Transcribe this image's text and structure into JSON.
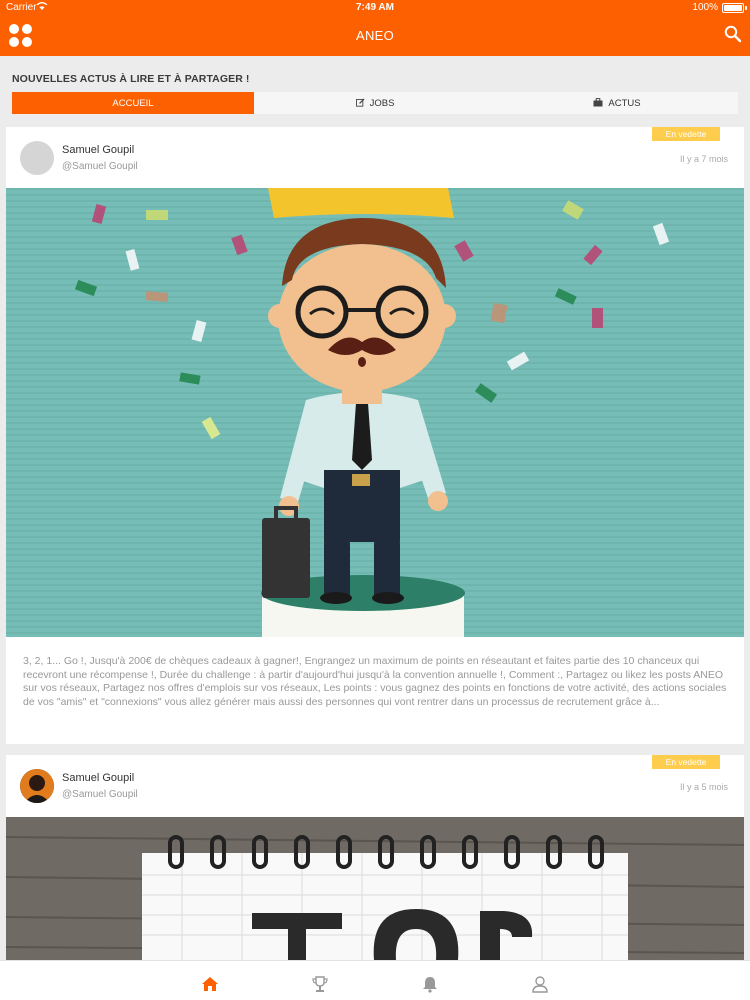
{
  "status_bar": {
    "carrier": "Carrier",
    "time": "7:49 AM",
    "battery": "100%"
  },
  "app_bar": {
    "title": "ANEO",
    "menu_icon": "grid-icon",
    "search_icon": "search-icon"
  },
  "colors": {
    "accent": "#fd6000",
    "badge": "#ffcd4d",
    "background": "#ececec"
  },
  "header": {
    "tagline": "NOUVELLES ACTUS À LIRE ET À PARTAGER !"
  },
  "tabs": [
    {
      "label": "ACCUEIL",
      "icon": null,
      "active": true
    },
    {
      "label": "JOBS",
      "icon": "edit-icon",
      "active": false
    },
    {
      "label": "ACTUS",
      "icon": "briefcase-icon",
      "active": false
    }
  ],
  "posts": [
    {
      "author": "Samuel Goupil",
      "handle": "@Samuel Goupil",
      "badge": "En vedette",
      "time_ago": "Il y a 7 mois",
      "image": "cartoon-man-with-crown-and-confetti",
      "excerpt": "3, 2, 1... Go !, Jusqu'à 200€ de chèques cadeaux à gagner!, Engrangez un maximum de points en réseautant et faites partie des 10 chanceux qui recevront une récompense !, Durée du challenge : à partir d'aujourd'hui jusqu'à la convention annuelle !, Comment :, Partagez ou likez les posts ANEO sur vos réseaux, Partagez nos offres d'emplois sur vos réseaux, Les points : vous gagnez des points en fonctions de votre activité, des actions sociales de vos \"amis\" et \"connexions\" vous allez générer mais aussi des personnes qui vont rentrer dans un processus de recrutement grâce à..."
    },
    {
      "author": "Samuel Goupil",
      "handle": "@Samuel Goupil",
      "badge": "En vedette",
      "time_ago": "Il y a 5 mois",
      "image": "top-notepad-on-wood"
    }
  ],
  "bottom_nav": [
    {
      "name": "home-icon",
      "active": true
    },
    {
      "name": "trophy-icon",
      "active": false
    },
    {
      "name": "bell-icon",
      "active": false
    },
    {
      "name": "profile-icon",
      "active": false
    }
  ]
}
